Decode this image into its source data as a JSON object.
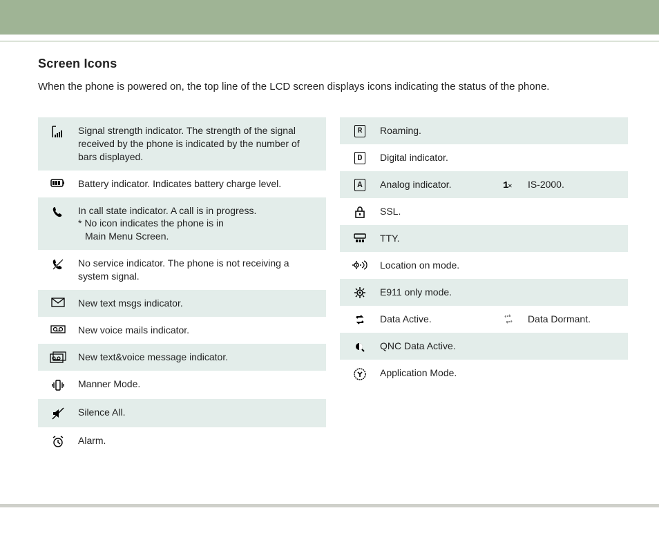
{
  "title": "Screen Icons",
  "intro": "When the phone is powered on, the top line of the LCD screen displays icons indicating the status of the phone.",
  "left": [
    {
      "icon": "signal-bars-icon",
      "shaded": true,
      "desc": "Signal strength indicator. The strength of the signal received by the phone is indicated by the number of bars displayed."
    },
    {
      "icon": "battery-icon",
      "shaded": false,
      "desc": "Battery indicator. Indicates battery charge level."
    },
    {
      "icon": "phone-icon",
      "shaded": true,
      "desc": "In call state indicator. A call is in progress.",
      "sub": "* No icon indicates the phone is in",
      "sub2": "Main Menu Screen."
    },
    {
      "icon": "no-service-icon",
      "shaded": false,
      "desc": "No service indicator. The phone is not receiving a system signal."
    },
    {
      "icon": "envelope-icon",
      "shaded": true,
      "desc": "New text msgs indicator."
    },
    {
      "icon": "voicemail-icon",
      "shaded": false,
      "desc": "New voice mails indicator."
    },
    {
      "icon": "text-voice-icon",
      "shaded": true,
      "desc": "New text&voice message indicator."
    },
    {
      "icon": "vibrate-icon",
      "shaded": false,
      "desc": "Manner Mode."
    },
    {
      "icon": "silence-icon",
      "shaded": true,
      "desc": "Silence All."
    },
    {
      "icon": "alarm-clock-icon",
      "shaded": false,
      "desc": "Alarm."
    }
  ],
  "right": [
    {
      "icon": "roaming-icon",
      "shaded": true,
      "desc": "Roaming."
    },
    {
      "icon": "digital-icon",
      "shaded": false,
      "desc": "Digital indicator."
    },
    {
      "icon": "analog-icon",
      "shaded": true,
      "dual": true,
      "desc": "Analog indicator.",
      "icon2": "is2000-icon",
      "desc2": "IS-2000."
    },
    {
      "icon": "lock-icon",
      "shaded": false,
      "desc": "SSL."
    },
    {
      "icon": "tty-icon",
      "shaded": true,
      "desc": "TTY."
    },
    {
      "icon": "location-on-icon",
      "shaded": false,
      "desc": "Location on mode."
    },
    {
      "icon": "e911-icon",
      "shaded": true,
      "desc": "E911 only mode."
    },
    {
      "icon": "data-active-icon",
      "shaded": false,
      "dual": true,
      "desc": "Data Active.",
      "icon2": "data-dormant-icon",
      "desc2": "Data Dormant."
    },
    {
      "icon": "qnc-icon",
      "shaded": true,
      "desc": "QNC Data Active."
    },
    {
      "icon": "app-mode-icon",
      "shaded": false,
      "desc": "Application Mode."
    }
  ]
}
